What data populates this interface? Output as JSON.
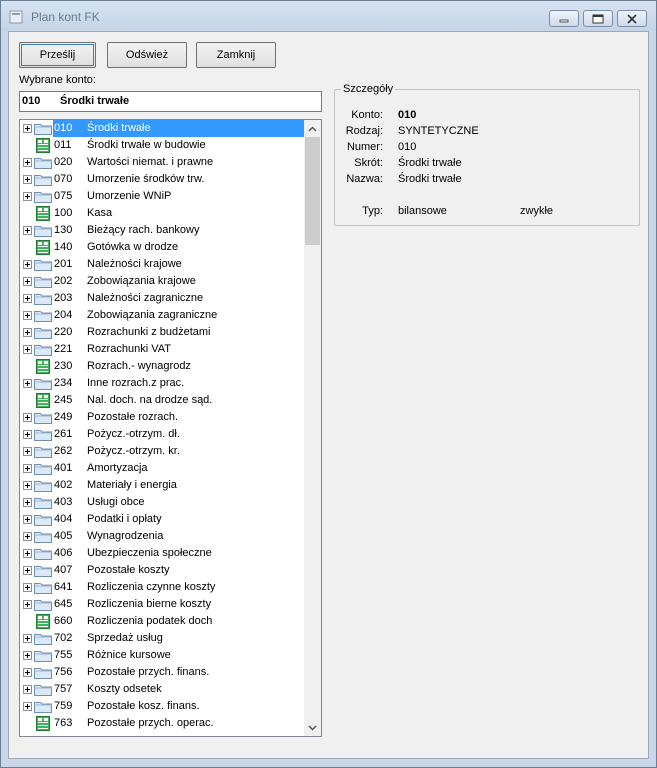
{
  "window": {
    "title": "Plan kont FK"
  },
  "toolbar": {
    "send_label": "Prześlij",
    "refresh_label": "Odśwież",
    "close_label": "Zamknij"
  },
  "selected": {
    "label": "Wybrane konto:",
    "code": "010",
    "name": "Środki trwałe"
  },
  "details": {
    "legend": "Szczegóły",
    "konto_label": "Konto:",
    "konto_value": "010",
    "rodzaj_label": "Rodzaj:",
    "rodzaj_value": "SYNTETYCZNE",
    "numer_label": "Numer:",
    "numer_value": "010",
    "skrot_label": "Skrót:",
    "skrot_value": "Środki trwałe",
    "nazwa_label": "Nazwa:",
    "nazwa_value": "Środki trwałe",
    "typ_label": "Typ:",
    "typ_value1": "bilansowe",
    "typ_value2": "zwykłe"
  },
  "accounts": [
    {
      "code": "010",
      "name": "Środki trwałe",
      "expandable": true,
      "selected": true
    },
    {
      "code": "011",
      "name": "Środki trwałe w budowie",
      "expandable": false
    },
    {
      "code": "020",
      "name": "Wartości niemat. i prawne",
      "expandable": true
    },
    {
      "code": "070",
      "name": "Umorzenie środków trw.",
      "expandable": true
    },
    {
      "code": "075",
      "name": "Umorzenie WNiP",
      "expandable": true
    },
    {
      "code": "100",
      "name": "Kasa",
      "expandable": false
    },
    {
      "code": "130",
      "name": "Bieżący rach. bankowy",
      "expandable": true
    },
    {
      "code": "140",
      "name": "Gotówka w drodze",
      "expandable": false
    },
    {
      "code": "201",
      "name": "Należności krajowe",
      "expandable": true
    },
    {
      "code": "202",
      "name": "Zobowiązania krajowe",
      "expandable": true
    },
    {
      "code": "203",
      "name": "Należności zagraniczne",
      "expandable": true
    },
    {
      "code": "204",
      "name": "Zobowiązania zagraniczne",
      "expandable": true
    },
    {
      "code": "220",
      "name": "Rozrachunki z budżetami",
      "expandable": true
    },
    {
      "code": "221",
      "name": "Rozrachunki VAT",
      "expandable": true
    },
    {
      "code": "230",
      "name": "Rozrach.- wynagrodz",
      "expandable": false
    },
    {
      "code": "234",
      "name": "Inne rozrach.z prac.",
      "expandable": true
    },
    {
      "code": "245",
      "name": "Nal. doch. na drodze sąd.",
      "expandable": false
    },
    {
      "code": "249",
      "name": "Pozostałe rozrach.",
      "expandable": true
    },
    {
      "code": "261",
      "name": "Pożycz.-otrzym. dł.",
      "expandable": true
    },
    {
      "code": "262",
      "name": "Pożycz.-otrzym. kr.",
      "expandable": true
    },
    {
      "code": "401",
      "name": "Amortyzacja",
      "expandable": true
    },
    {
      "code": "402",
      "name": "Materiały i energia",
      "expandable": true
    },
    {
      "code": "403",
      "name": "Usługi obce",
      "expandable": true
    },
    {
      "code": "404",
      "name": "Podatki i opłaty",
      "expandable": true
    },
    {
      "code": "405",
      "name": "Wynagrodzenia",
      "expandable": true
    },
    {
      "code": "406",
      "name": "Ubezpieczenia społeczne",
      "expandable": true
    },
    {
      "code": "407",
      "name": "Pozostałe koszty",
      "expandable": true
    },
    {
      "code": "641",
      "name": "Rozliczenia czynne koszty",
      "expandable": true
    },
    {
      "code": "645",
      "name": "Rozliczenia bierne koszty",
      "expandable": true
    },
    {
      "code": "660",
      "name": "Rozliczenia podatek doch",
      "expandable": false
    },
    {
      "code": "702",
      "name": "Sprzedaż usług",
      "expandable": true
    },
    {
      "code": "755",
      "name": "Różnice kursowe",
      "expandable": true
    },
    {
      "code": "756",
      "name": "Pozostałe przych. finans.",
      "expandable": true
    },
    {
      "code": "757",
      "name": "Koszty odsetek",
      "expandable": true
    },
    {
      "code": "759",
      "name": "Pozostałe kosz. finans.",
      "expandable": true
    },
    {
      "code": "763",
      "name": "Pozostałe przych. operac.",
      "expandable": false
    }
  ]
}
